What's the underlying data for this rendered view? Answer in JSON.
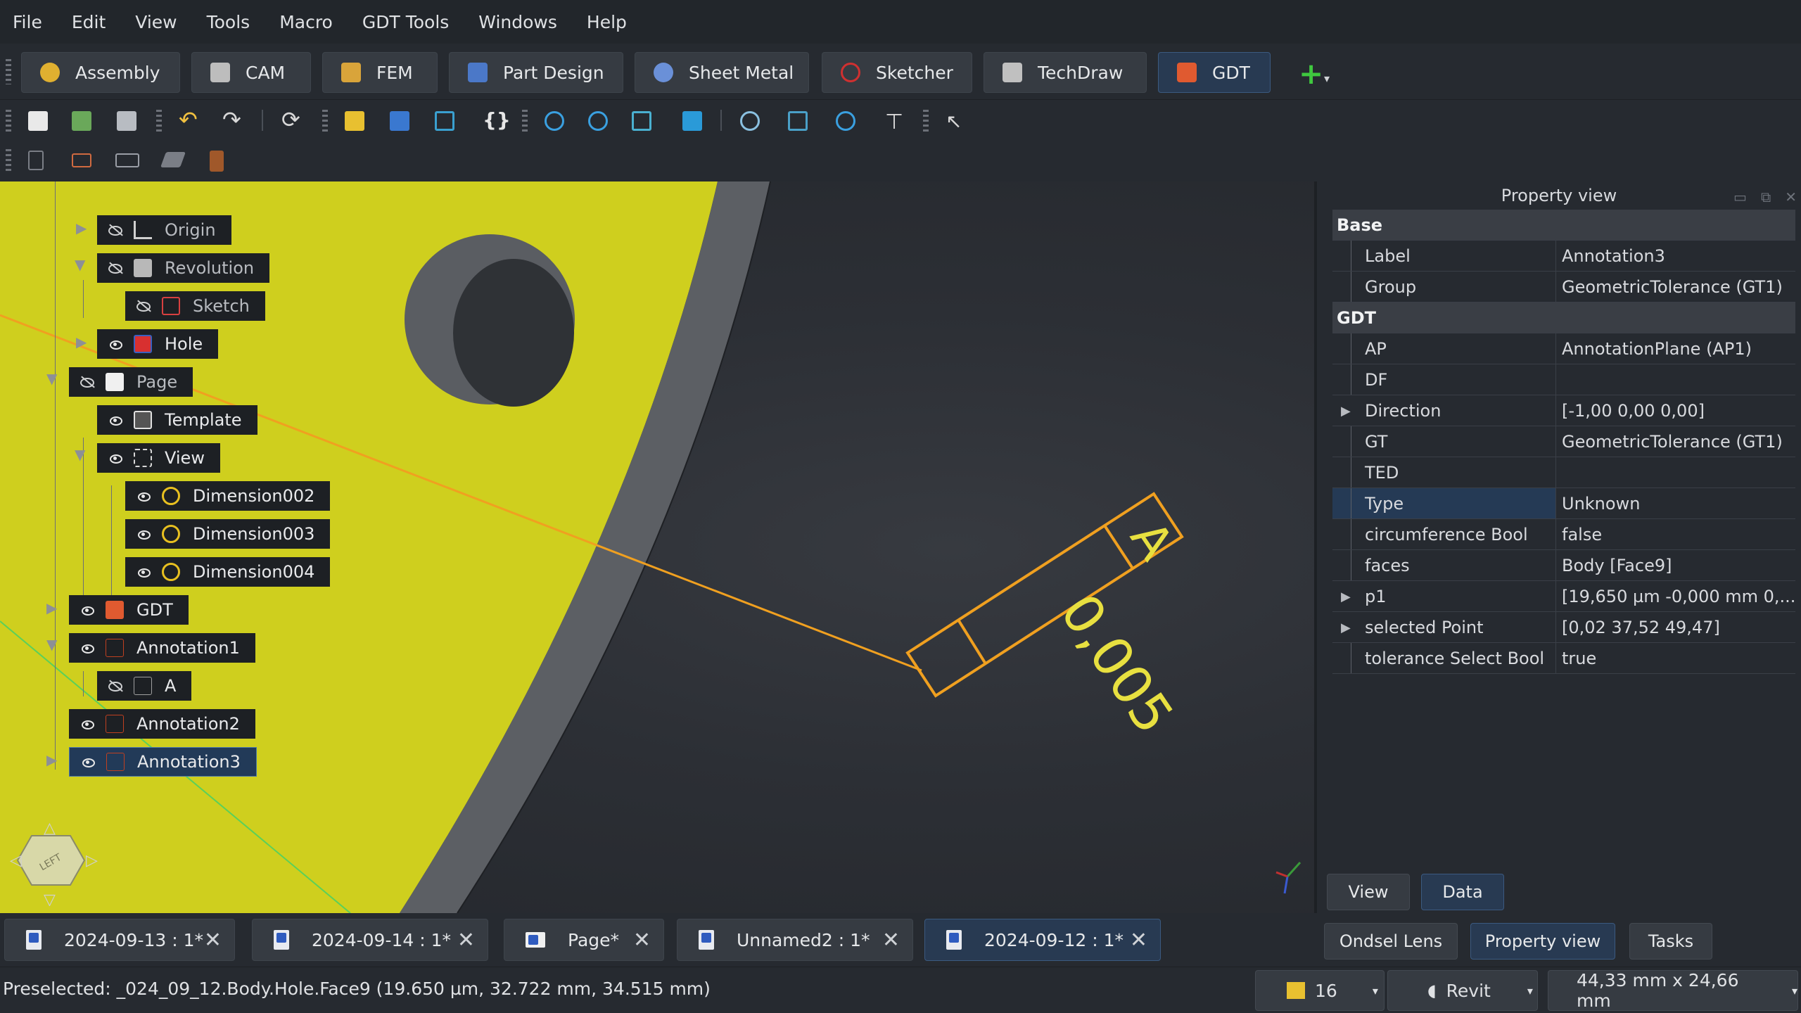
{
  "menu": [
    "File",
    "Edit",
    "View",
    "Tools",
    "Macro",
    "GDT Tools",
    "Windows",
    "Help"
  ],
  "workbenches": [
    {
      "label": "Assembly",
      "color": "#e0b030"
    },
    {
      "label": "CAM",
      "color": "#c8c8c8"
    },
    {
      "label": "FEM",
      "color": "#d9a43a"
    },
    {
      "label": "Part Design",
      "color": "#4b78c8"
    },
    {
      "label": "Sheet Metal",
      "color": "#6a90d8"
    },
    {
      "label": "Sketcher",
      "color": "#d03030"
    },
    {
      "label": "TechDraw",
      "color": "#c0c0c0"
    },
    {
      "label": "GDT",
      "color": "#e05a30"
    }
  ],
  "tree": {
    "items": [
      {
        "label": "Origin",
        "vis": "hidden",
        "icon_color": "#d0d0d0",
        "expand": "collapsed"
      },
      {
        "label": "Revolution",
        "vis": "hidden",
        "icon_color": "#b8b8b8",
        "expand": "expanded"
      },
      {
        "label": "Sketch",
        "vis": "hidden",
        "icon_color": "#d84040",
        "expand": "none"
      },
      {
        "label": "Hole",
        "vis": "visible",
        "icon_color": "#d83030",
        "expand": "collapsed"
      },
      {
        "label": "Page",
        "vis": "hidden",
        "icon_color": "#f0f0f0",
        "expand": "expanded"
      },
      {
        "label": "Template",
        "vis": "visible",
        "icon_color": "#e0e0e0",
        "expand": "none"
      },
      {
        "label": "View",
        "vis": "visible",
        "icon_color": "#d8d8d8",
        "expand": "expanded"
      },
      {
        "label": "Dimension002",
        "vis": "visible",
        "icon_color": "#e8c020",
        "expand": "none"
      },
      {
        "label": "Dimension003",
        "vis": "visible",
        "icon_color": "#e8c020",
        "expand": "none"
      },
      {
        "label": "Dimension004",
        "vis": "visible",
        "icon_color": "#e8c020",
        "expand": "none"
      },
      {
        "label": "GDT",
        "vis": "visible",
        "icon_color": "#e05a30",
        "expand": "collapsed"
      },
      {
        "label": "Annotation1",
        "vis": "visible",
        "icon_color": "#c04020",
        "expand": "expanded"
      },
      {
        "label": "A",
        "vis": "hidden",
        "icon_color": "#a0a0a0",
        "expand": "none"
      },
      {
        "label": "Annotation2",
        "vis": "visible",
        "icon_color": "#c04020",
        "expand": "none"
      },
      {
        "label": "Annotation3",
        "vis": "visible",
        "icon_color": "#c04020",
        "expand": "collapsed",
        "selected": true
      }
    ]
  },
  "viewport": {
    "annotation_value": "0,005",
    "datum_letter": "A",
    "navcube_face": "LEFT"
  },
  "property_panel": {
    "title": "Property view",
    "groups": [
      {
        "name": "Base",
        "rows": [
          {
            "key": "Label",
            "value": "Annotation3"
          },
          {
            "key": "Group",
            "value": "GeometricTolerance (GT1)"
          }
        ]
      },
      {
        "name": "GDT",
        "rows": [
          {
            "key": "AP",
            "value": "AnnotationPlane (AP1)"
          },
          {
            "key": "DF",
            "value": ""
          },
          {
            "key": "Direction",
            "value": "[-1,00 0,00 0,00]",
            "expandable": true
          },
          {
            "key": "GT",
            "value": "GeometricTolerance (GT1)"
          },
          {
            "key": "TED",
            "value": ""
          },
          {
            "key": "Type",
            "value": "Unknown",
            "selected": true
          },
          {
            "key": "circumference Bool",
            "value": "false"
          },
          {
            "key": "faces",
            "value": "Body [Face9]"
          },
          {
            "key": "p1",
            "value": "[19,650 µm  -0,000 mm  0,...",
            "expandable": true
          },
          {
            "key": "selected Point",
            "value": "[0,02 37,52 49,47]",
            "expandable": true
          },
          {
            "key": "tolerance Select Bool",
            "value": "true"
          }
        ]
      }
    ],
    "view_tab": "View",
    "data_tab": "Data"
  },
  "panel_tabs": [
    "Ondsel Lens",
    "Property view",
    "Tasks"
  ],
  "doc_tabs": [
    "2024-09-13 : 1*",
    "2024-09-14 : 1*",
    "Page*",
    "Unnamed2 : 1*",
    "2024-09-12 : 1*"
  ],
  "status": {
    "message": "Preselected: _024_09_12.Body.Hole.Face9 (19.650 µm, 32.722 mm, 34.515 mm)",
    "count": "16",
    "nav_style": "Revit",
    "dimensions": "44,33 mm x 24,66 mm"
  }
}
